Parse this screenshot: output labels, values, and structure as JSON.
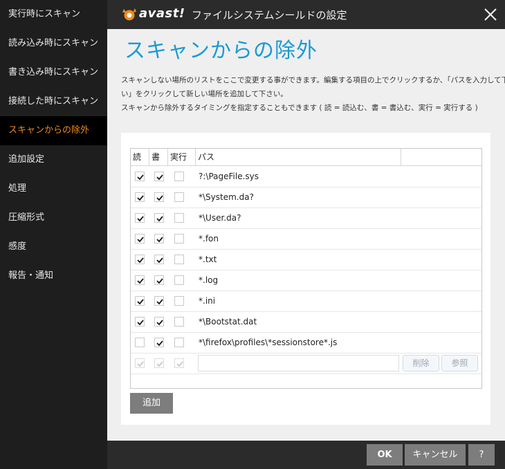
{
  "sidebar": {
    "items": [
      {
        "label": "実行時にスキャン"
      },
      {
        "label": "読み込み時にスキャン"
      },
      {
        "label": "書き込み時にスキャン"
      },
      {
        "label": "接続した時にスキャン"
      },
      {
        "label": "スキャンからの除外",
        "active": true
      },
      {
        "label": "追加設定"
      },
      {
        "label": "処理"
      },
      {
        "label": "圧縮形式"
      },
      {
        "label": "感度"
      },
      {
        "label": "報告・通知"
      }
    ]
  },
  "titlebar": {
    "logo_text": "avast!",
    "title": "ファイルシステムシールドの設定"
  },
  "page": {
    "title": "スキャンからの除外",
    "description": [
      "スキャンしない場所のリストをここで変更する事ができます。編集する項目の上でクリックするか、「パスを入力して下さ",
      "い」をクリックして新しい場所を追加して下さい。",
      "スキャンから除外するタイミングを指定することもできます ( 読 = 読込む、書 = 書込む、実行 = 実行する )"
    ]
  },
  "table": {
    "headers": {
      "read": "読",
      "write": "書",
      "exec": "実行",
      "path": "パス"
    },
    "rows": [
      {
        "read": true,
        "write": true,
        "exec": false,
        "path": "?:\\PageFile.sys"
      },
      {
        "read": true,
        "write": true,
        "exec": false,
        "path": "*\\System.da?"
      },
      {
        "read": true,
        "write": true,
        "exec": false,
        "path": "*\\User.da?"
      },
      {
        "read": true,
        "write": true,
        "exec": false,
        "path": "*.fon"
      },
      {
        "read": true,
        "write": true,
        "exec": false,
        "path": "*.txt"
      },
      {
        "read": true,
        "write": true,
        "exec": false,
        "path": "*.log"
      },
      {
        "read": true,
        "write": true,
        "exec": false,
        "path": "*.ini"
      },
      {
        "read": true,
        "write": true,
        "exec": false,
        "path": "*\\Bootstat.dat"
      },
      {
        "read": false,
        "write": true,
        "exec": false,
        "path": "*\\firefox\\profiles\\*sessionstore*.js"
      }
    ],
    "new_row": {
      "path_value": "",
      "delete_label": "削除",
      "browse_label": "参照"
    }
  },
  "buttons": {
    "add": "追加",
    "ok": "OK",
    "cancel": "キャンセル",
    "help": "?"
  },
  "colors": {
    "accent_orange": "#f08a1c",
    "title_blue": "#1a9ad6",
    "button_gray": "#7d7d7d"
  }
}
